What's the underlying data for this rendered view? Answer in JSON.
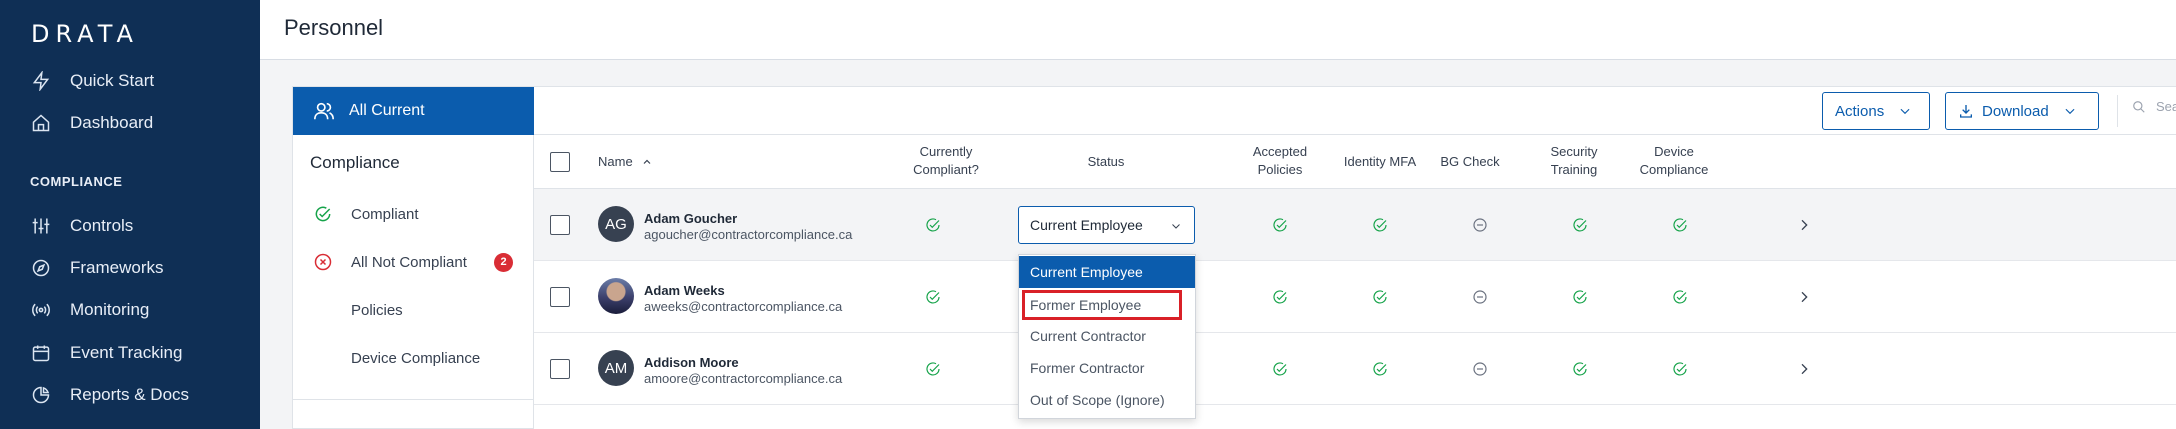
{
  "brand": {
    "logo": "DRATA"
  },
  "sidebar": {
    "items": [
      {
        "label": "Quick Start",
        "icon": "lightning-icon"
      },
      {
        "label": "Dashboard",
        "icon": "home-icon"
      },
      {
        "label": "Controls",
        "icon": "sliders-icon"
      },
      {
        "label": "Frameworks",
        "icon": "compass-icon"
      },
      {
        "label": "Monitoring",
        "icon": "broadcast-icon"
      },
      {
        "label": "Event Tracking",
        "icon": "calendar-icon"
      },
      {
        "label": "Reports & Docs",
        "icon": "pie-chart-icon"
      }
    ],
    "section_compliance": "COMPLIANCE"
  },
  "header": {
    "title": "Personnel"
  },
  "filters": {
    "active": "All Current",
    "heading": "Compliance",
    "items": [
      {
        "label": "Compliant",
        "icon": "check-circle-icon"
      },
      {
        "label": "All Not Compliant",
        "icon": "x-circle-icon",
        "badge": "2"
      },
      {
        "label": "Policies"
      },
      {
        "label": "Device Compliance"
      }
    ]
  },
  "toolbar": {
    "actions_label": "Actions",
    "download_label": "Download",
    "search_placeholder": "Sea"
  },
  "table": {
    "columns": {
      "name": "Name",
      "compliant": [
        "Currently",
        "Compliant?"
      ],
      "status": "Status",
      "accepted_policies": [
        "Accepted",
        "Policies"
      ],
      "identity_mfa": "Identity MFA",
      "bg_check": "BG Check",
      "security_training": [
        "Security",
        "Training"
      ],
      "device_compliance": [
        "Device",
        "Compliance"
      ]
    },
    "rows": [
      {
        "initials": "AG",
        "name": "Adam Goucher",
        "email": "agoucher@contractorcompliance.ca",
        "status": "Current Employee"
      },
      {
        "initials": "",
        "name": "Adam Weeks",
        "email": "aweeks@contractorcompliance.ca"
      },
      {
        "initials": "AM",
        "name": "Addison Moore",
        "email": "amoore@contractorcompliance.ca"
      }
    ]
  },
  "status_dropdown": {
    "options": [
      "Current Employee",
      "Former Employee",
      "Current Contractor",
      "Former Contractor",
      "Out of Scope (Ignore)"
    ],
    "selected": "Current Employee",
    "highlighted": "Former Employee"
  },
  "colors": {
    "sidebar_bg": "#0f2f55",
    "accent": "#0b5cad",
    "success": "#16a34a",
    "error": "#d92d35",
    "neutral_icon": "#6b7280"
  }
}
